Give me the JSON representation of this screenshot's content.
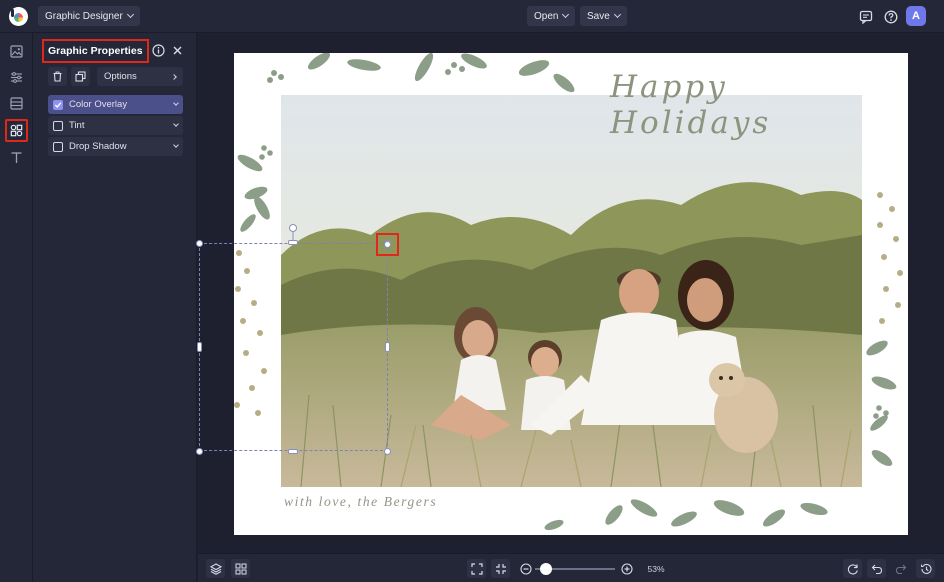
{
  "topbar": {
    "mode_label": "Graphic Designer",
    "open_label": "Open",
    "save_label": "Save",
    "avatar_initial": "A",
    "icons": [
      "logo",
      "chevron-down-icon",
      "chat-icon",
      "help-icon"
    ]
  },
  "rail": {
    "items": [
      "image-icon",
      "sliders-icon",
      "layout-icon",
      "graphics-icon",
      "text-icon"
    ],
    "active": "graphics-icon"
  },
  "panel": {
    "title": "Graphic Properties",
    "options_label": "Options",
    "rows": [
      {
        "label": "Color Overlay",
        "checked": true
      },
      {
        "label": "Tint",
        "checked": false
      },
      {
        "label": "Drop Shadow",
        "checked": false
      }
    ]
  },
  "canvas": {
    "title_text": "Happy Holidays",
    "signature_text": "with love, the Bergers",
    "leaf_color": "#8c9e87",
    "dot_color": "#b6ad84"
  },
  "bottombar": {
    "zoom_label": "53%",
    "icons": [
      "layers-icon",
      "grid-icon",
      "fit-screen-icon",
      "actual-size-icon",
      "zoom-out-icon",
      "zoom-in-icon",
      "rotate-icon",
      "undo-icon",
      "redo-icon",
      "history-icon"
    ]
  },
  "colors": {
    "app_bg": "#1e2030",
    "chrome_bg": "#242738",
    "accent": "#6f78ea",
    "highlight": "#e0281a"
  }
}
